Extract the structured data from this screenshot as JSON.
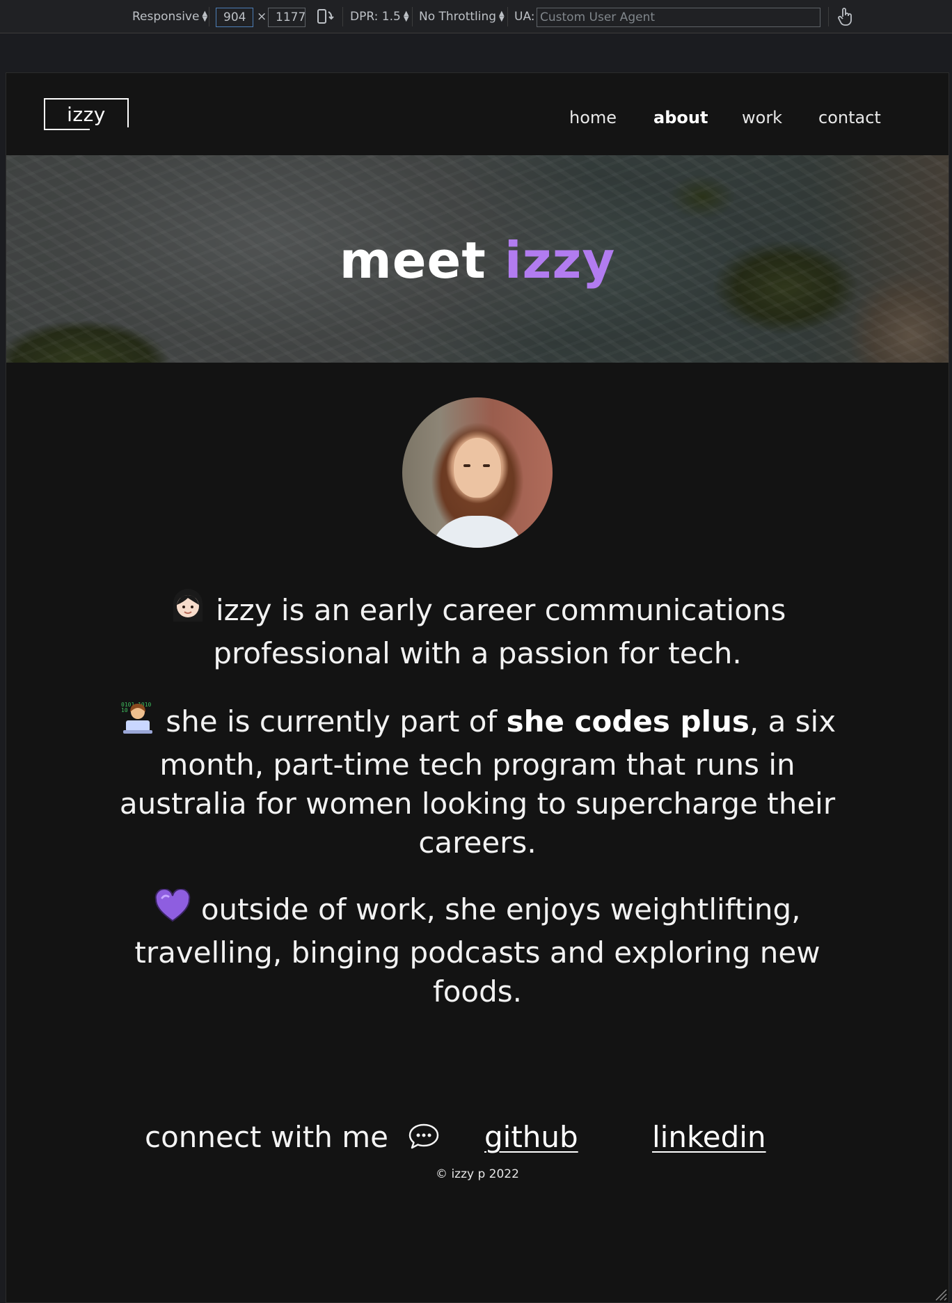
{
  "devtools": {
    "device": "Responsive",
    "width": "904",
    "height": "1177",
    "times": "×",
    "dpr": "DPR: 1.5",
    "throttling": "No Throttling",
    "ua_label": "UA:",
    "ua_placeholder": "Custom User Agent"
  },
  "site": {
    "logo": "izzy",
    "nav": [
      "home",
      "about",
      "work",
      "contact"
    ],
    "active_nav": "about",
    "hero": {
      "title_plain": "meet",
      "title_accent": "izzy"
    },
    "accent_color": "#b27cf0",
    "bio": {
      "p1": "izzy is an early career communications professional with a passion for tech.",
      "p1_emoji": "woman-icon",
      "p2_before": "she is currently part of",
      "p2_bold": "she codes plus",
      "p2_after": ", a six month, part-time tech program that runs in australia for women looking to supercharge their careers.",
      "p2_emoji": "woman-technologist-icon",
      "p3": "outside of work, she enjoys weightlifting, travelling, binging podcasts and exploring new foods.",
      "p3_emoji": "purple-heart-icon"
    },
    "connect": {
      "label": "connect with me",
      "icon": "speech-bubble-icon",
      "github": "github",
      "linkedin": "linkedin"
    },
    "footer": "© izzy p 2022"
  }
}
